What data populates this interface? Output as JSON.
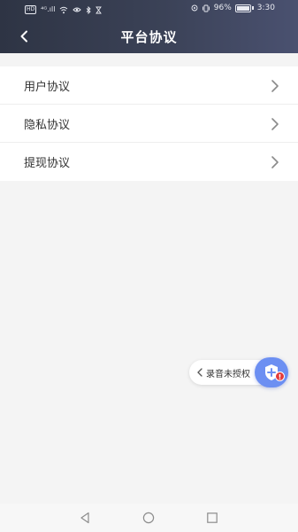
{
  "status_bar": {
    "hd": "HD",
    "signal_label": "⁴ᴳ.ıll",
    "battery_percent": "96%",
    "time": "3:30"
  },
  "navbar": {
    "title": "平台协议",
    "back_icon": "chevron-left-icon"
  },
  "menu": {
    "items": [
      {
        "label": "用户协议",
        "icon": "chevron-right-icon"
      },
      {
        "label": "隐私协议",
        "icon": "chevron-right-icon"
      },
      {
        "label": "提现协议",
        "icon": "chevron-right-icon"
      }
    ]
  },
  "float_widget": {
    "label": "录音未授权",
    "badge": "!",
    "icon": "shield-plus-icon"
  },
  "colors": {
    "header_start": "#2e3444",
    "header_end": "#4a5170",
    "accent": "#6c8ff2",
    "badge": "#e33b3b"
  }
}
